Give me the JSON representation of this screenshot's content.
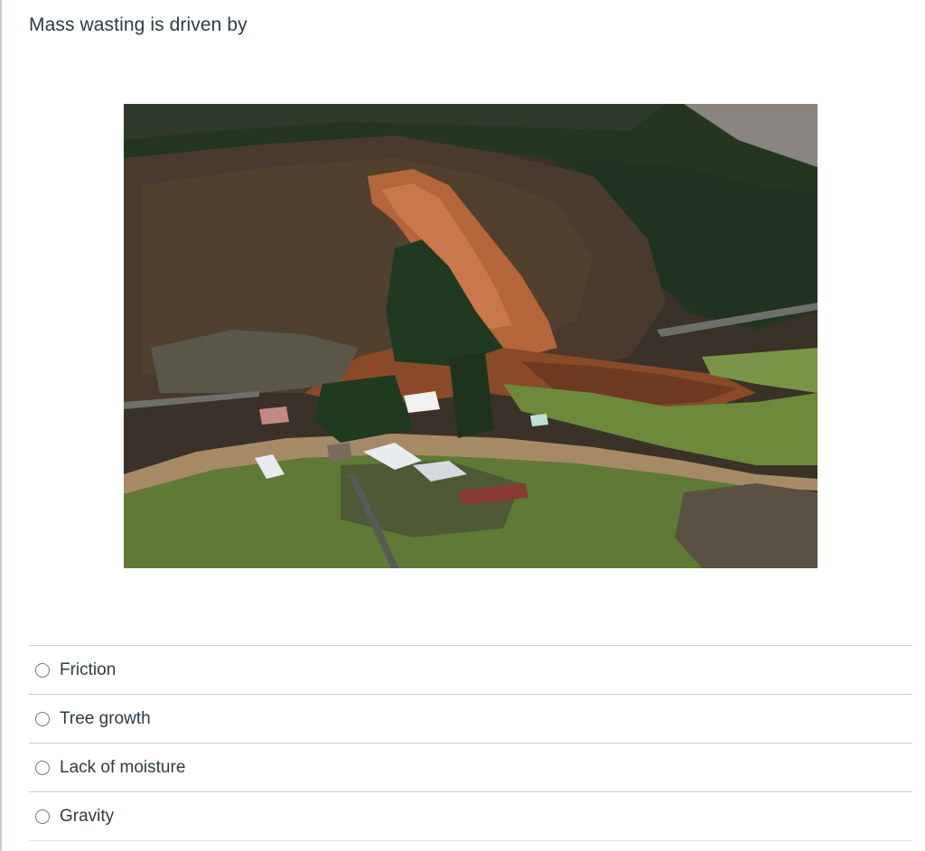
{
  "question": {
    "text": "Mass wasting is driven by"
  },
  "image": {
    "subject": "landslide-photo"
  },
  "answers": [
    {
      "label": "Friction"
    },
    {
      "label": "Tree growth"
    },
    {
      "label": "Lack of moisture"
    },
    {
      "label": "Gravity"
    }
  ],
  "colors": {
    "text": "#2d3b45",
    "divider": "#c7cdd1",
    "radio_border": "#6b7780"
  }
}
